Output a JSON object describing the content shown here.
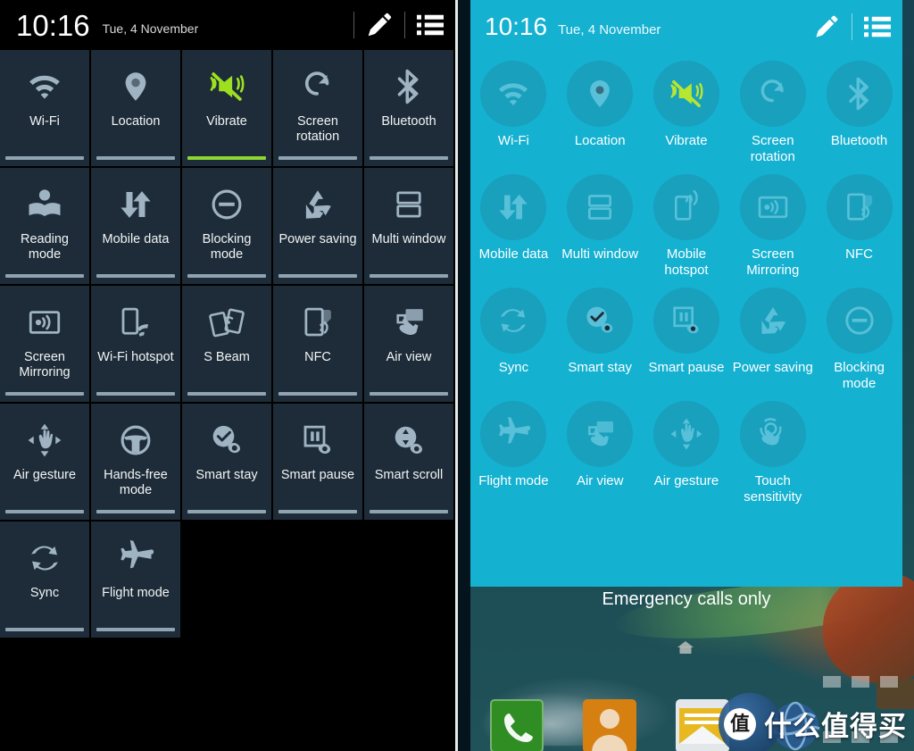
{
  "left": {
    "status": {
      "clock": "10:16",
      "date": "Tue, 4 November",
      "edit_icon": "pencil-icon",
      "list_icon": "list-icon"
    },
    "theme": {
      "background": "#000000",
      "tile_background": "#1d2c38",
      "label_color": "#f2f4f6",
      "bar_off_color": "#8fa3b2",
      "bar_on_color": "#8ed632",
      "active_icon_color": "#9de020"
    },
    "tiles": [
      {
        "label": "Wi-Fi",
        "icon": "wifi-icon",
        "on": false
      },
      {
        "label": "Location",
        "icon": "location-pin-icon",
        "on": false
      },
      {
        "label": "Vibrate",
        "icon": "vibrate-mute-icon",
        "on": true
      },
      {
        "label": "Screen rotation",
        "icon": "screen-rotation-icon",
        "on": false
      },
      {
        "label": "Bluetooth",
        "icon": "bluetooth-icon",
        "on": false
      },
      {
        "label": "Reading mode",
        "icon": "reading-mode-icon",
        "on": false
      },
      {
        "label": "Mobile data",
        "icon": "mobile-data-icon",
        "on": false
      },
      {
        "label": "Blocking mode",
        "icon": "blocking-mode-icon",
        "on": false
      },
      {
        "label": "Power saving",
        "icon": "power-saving-icon",
        "on": false
      },
      {
        "label": "Multi window",
        "icon": "multi-window-icon",
        "on": false
      },
      {
        "label": "Screen Mirroring",
        "icon": "screen-mirroring-icon",
        "on": false
      },
      {
        "label": "Wi-Fi hotspot",
        "icon": "wifi-hotspot-icon",
        "on": false
      },
      {
        "label": "S Beam",
        "icon": "s-beam-icon",
        "on": false
      },
      {
        "label": "NFC",
        "icon": "nfc-icon",
        "on": false
      },
      {
        "label": "Air view",
        "icon": "air-view-icon",
        "on": false
      },
      {
        "label": "Air gesture",
        "icon": "air-gesture-icon",
        "on": false
      },
      {
        "label": "Hands-free mode",
        "icon": "hands-free-icon",
        "on": false
      },
      {
        "label": "Smart stay",
        "icon": "smart-stay-icon",
        "on": false
      },
      {
        "label": "Smart pause",
        "icon": "smart-pause-icon",
        "on": false
      },
      {
        "label": "Smart scroll",
        "icon": "smart-scroll-icon",
        "on": false
      },
      {
        "label": "Sync",
        "icon": "sync-icon",
        "on": false
      },
      {
        "label": "Flight mode",
        "icon": "flight-mode-icon",
        "on": false
      }
    ]
  },
  "right": {
    "status": {
      "clock": "10:16",
      "date": "Tue, 4 November",
      "edit_icon": "pencil-icon",
      "list_icon": "list-icon"
    },
    "theme": {
      "panel_background": "#14b1d1",
      "circle_background": "#18a0bd",
      "label_color": "#ffffff",
      "active_icon_color": "#b6e630"
    },
    "tiles": [
      {
        "label": "Wi-Fi",
        "icon": "wifi-icon",
        "on": false
      },
      {
        "label": "Location",
        "icon": "location-pin-icon",
        "on": false
      },
      {
        "label": "Vibrate",
        "icon": "vibrate-mute-icon",
        "on": true
      },
      {
        "label": "Screen rotation",
        "icon": "screen-rotation-icon",
        "on": false
      },
      {
        "label": "Bluetooth",
        "icon": "bluetooth-icon",
        "on": false
      },
      {
        "label": "Mobile data",
        "icon": "mobile-data-icon",
        "on": false
      },
      {
        "label": "Multi window",
        "icon": "multi-window-icon",
        "on": false
      },
      {
        "label": "Mobile hotspot",
        "icon": "mobile-hotspot-icon",
        "on": false
      },
      {
        "label": "Screen Mirroring",
        "icon": "screen-mirroring-icon",
        "on": false
      },
      {
        "label": "NFC",
        "icon": "nfc-icon",
        "on": false
      },
      {
        "label": "Sync",
        "icon": "sync-icon",
        "on": false
      },
      {
        "label": "Smart stay",
        "icon": "smart-stay-icon",
        "on": false
      },
      {
        "label": "Smart pause",
        "icon": "smart-pause-icon",
        "on": false
      },
      {
        "label": "Power saving",
        "icon": "power-saving-icon",
        "on": false
      },
      {
        "label": "Blocking mode",
        "icon": "blocking-mode-icon",
        "on": false
      },
      {
        "label": "Flight mode",
        "icon": "flight-mode-icon",
        "on": false
      },
      {
        "label": "Air view",
        "icon": "air-view-icon",
        "on": false
      },
      {
        "label": "Air gesture",
        "icon": "air-gesture-icon",
        "on": false
      },
      {
        "label": "Touch sensitivity",
        "icon": "touch-sensitivity-icon",
        "on": false
      }
    ],
    "carrier_status": "Emergency calls only",
    "home_indicator_icon": "home-icon",
    "dock": [
      {
        "name": "Phone",
        "icon": "phone-icon",
        "color": "#2f8d24"
      },
      {
        "name": "Contacts",
        "icon": "contacts-icon",
        "color": "#d78012"
      },
      {
        "name": "Messaging",
        "icon": "envelope-icon",
        "color": "#e3e7ea"
      },
      {
        "name": "Internet",
        "icon": "globe-icon",
        "color": "#2a5a8c"
      }
    ]
  },
  "watermark": {
    "badge_text": "值",
    "text": "什么值得买",
    "globe_icon": "globe-icon",
    "grid_icon": "grid-dots-icon"
  }
}
